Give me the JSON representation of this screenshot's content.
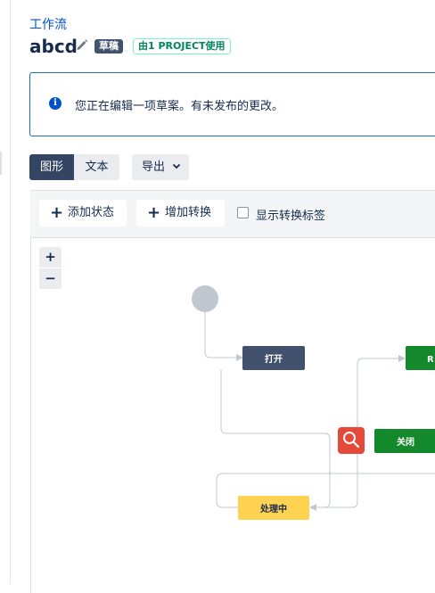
{
  "header": {
    "breadcrumb": "工作流",
    "title": "abcd",
    "draft_badge": "草稿",
    "usage_badge": "由1 PROJECT使用"
  },
  "info_message": "您正在编辑一项草案。有未发布的更改。",
  "view_tabs": [
    {
      "label": "图形",
      "active": true
    },
    {
      "label": "文本",
      "active": false
    }
  ],
  "export_label": "导出",
  "toolbar": {
    "add_status": "添加状态",
    "add_transition": "增加转换",
    "show_labels": "显示转换标签",
    "show_labels_checked": false
  },
  "zoom": {
    "in": "+",
    "out": "−"
  },
  "diagram": {
    "nodes": [
      {
        "label": "打开",
        "color": "#42526e"
      },
      {
        "label": "R",
        "color": "#14892c"
      },
      {
        "label": "关闭",
        "color": "#14892c"
      },
      {
        "label": "处理中",
        "color": "#ffd351"
      }
    ]
  },
  "colors": {
    "link": "#0052cc",
    "dark_tab": "#344563",
    "status_blue": "#42526e",
    "status_green": "#14892c",
    "status_yellow": "#ffd351",
    "search_handle": "#e5493a"
  }
}
